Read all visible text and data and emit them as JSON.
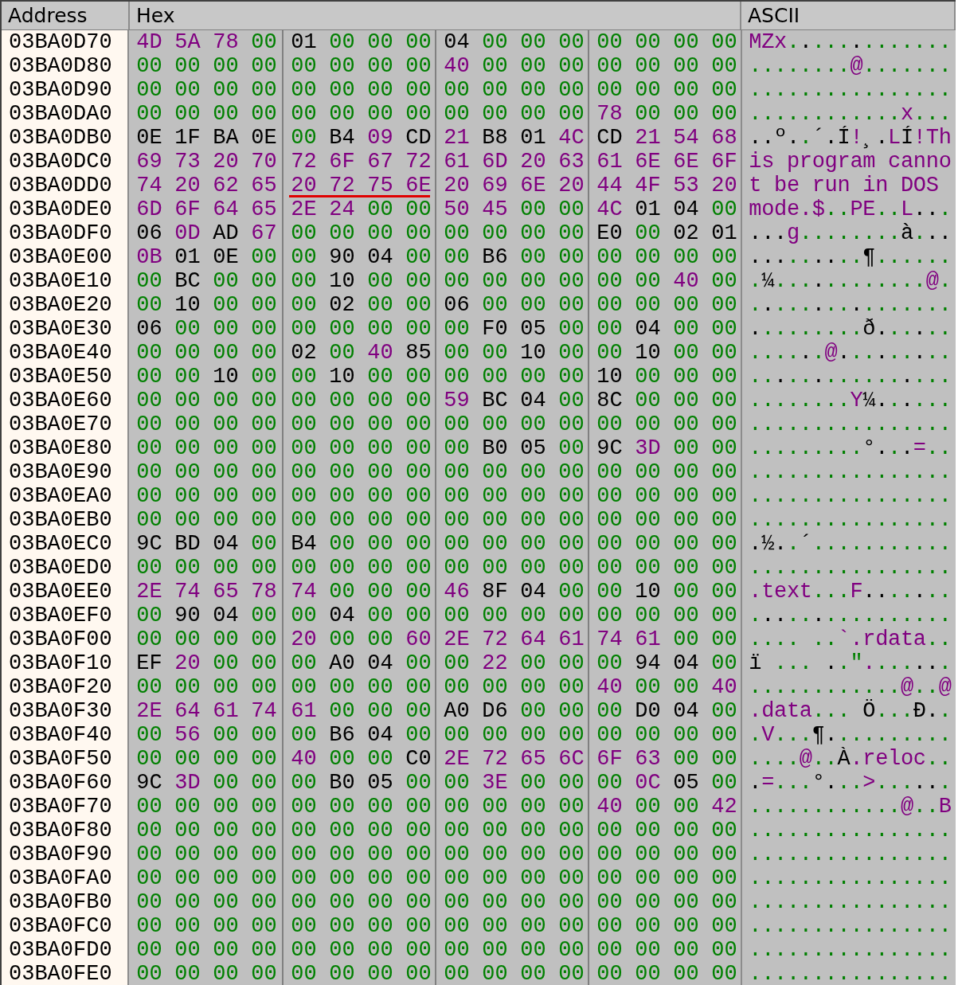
{
  "columns": [
    "Address",
    "Hex",
    "ASCII"
  ],
  "rows": [
    {
      "address": "03BA0D70",
      "hex": [
        "4D 5A 78 00",
        "01 00 00 00",
        "04 00 00 00",
        "00 00 00 00"
      ],
      "underlined": [
        false,
        false,
        false,
        false
      ],
      "ascii": "MZx............."
    },
    {
      "address": "03BA0D80",
      "hex": [
        "00 00 00 00",
        "00 00 00 00",
        "40 00 00 00",
        "00 00 00 00"
      ],
      "underlined": [
        false,
        false,
        false,
        false
      ],
      "ascii": "........@......."
    },
    {
      "address": "03BA0D90",
      "hex": [
        "00 00 00 00",
        "00 00 00 00",
        "00 00 00 00",
        "00 00 00 00"
      ],
      "underlined": [
        false,
        false,
        false,
        false
      ],
      "ascii": "................"
    },
    {
      "address": "03BA0DA0",
      "hex": [
        "00 00 00 00",
        "00 00 00 00",
        "00 00 00 00",
        "78 00 00 00"
      ],
      "underlined": [
        false,
        false,
        false,
        false
      ],
      "ascii": "............x..."
    },
    {
      "address": "03BA0DB0",
      "hex": [
        "0E 1F BA 0E",
        "00 B4 09 CD",
        "21 B8 01 4C",
        "CD 21 54 68"
      ],
      "underlined": [
        false,
        false,
        false,
        false
      ],
      "ascii": "..º..´.Í!¸.LÍ!Th"
    },
    {
      "address": "03BA0DC0",
      "hex": [
        "69 73 20 70",
        "72 6F 67 72",
        "61 6D 20 63",
        "61 6E 6E 6F"
      ],
      "underlined": [
        false,
        false,
        false,
        false
      ],
      "ascii": "is program canno"
    },
    {
      "address": "03BA0DD0",
      "hex": [
        "74 20 62 65",
        "20 72 75 6E",
        "20 69 6E 20",
        "44 4F 53 20"
      ],
      "underlined": [
        false,
        true,
        false,
        false
      ],
      "ascii": "t be run in DOS "
    },
    {
      "address": "03BA0DE0",
      "hex": [
        "6D 6F 64 65",
        "2E 24 00 00",
        "50 45 00 00",
        "4C 01 04 00"
      ],
      "underlined": [
        false,
        false,
        false,
        false
      ],
      "ascii": "mode.$..PE..L..."
    },
    {
      "address": "03BA0DF0",
      "hex": [
        "06 0D AD 67",
        "00 00 00 00",
        "00 00 00 00",
        "E0 00 02 01"
      ],
      "underlined": [
        false,
        false,
        false,
        false
      ],
      "ascii": "...g........à..."
    },
    {
      "address": "03BA0E00",
      "hex": [
        "0B 01 0E 00",
        "00 90 04 00",
        "00 B6 00 00",
        "00 00 00 00"
      ],
      "underlined": [
        false,
        false,
        false,
        false
      ],
      "ascii": ".........¶......"
    },
    {
      "address": "03BA0E10",
      "hex": [
        "00 BC 00 00",
        "00 10 00 00",
        "00 00 00 00",
        "00 00 40 00"
      ],
      "underlined": [
        false,
        false,
        false,
        false
      ],
      "ascii": ".¼............@."
    },
    {
      "address": "03BA0E20",
      "hex": [
        "00 10 00 00",
        "00 02 00 00",
        "06 00 00 00",
        "00 00 00 00"
      ],
      "underlined": [
        false,
        false,
        false,
        false
      ],
      "ascii": "................"
    },
    {
      "address": "03BA0E30",
      "hex": [
        "06 00 00 00",
        "00 00 00 00",
        "00 F0 05 00",
        "00 04 00 00"
      ],
      "underlined": [
        false,
        false,
        false,
        false
      ],
      "ascii": ".........ð......"
    },
    {
      "address": "03BA0E40",
      "hex": [
        "00 00 00 00",
        "02 00 40 85",
        "00 00 10 00",
        "00 10 00 00"
      ],
      "underlined": [
        false,
        false,
        false,
        false
      ],
      "ascii": "......@........."
    },
    {
      "address": "03BA0E50",
      "hex": [
        "00 00 10 00",
        "00 10 00 00",
        "00 00 00 00",
        "10 00 00 00"
      ],
      "underlined": [
        false,
        false,
        false,
        false
      ],
      "ascii": "................"
    },
    {
      "address": "03BA0E60",
      "hex": [
        "00 00 00 00",
        "00 00 00 00",
        "59 BC 04 00",
        "8C 00 00 00"
      ],
      "underlined": [
        false,
        false,
        false,
        false
      ],
      "ascii": "........Y¼......"
    },
    {
      "address": "03BA0E70",
      "hex": [
        "00 00 00 00",
        "00 00 00 00",
        "00 00 00 00",
        "00 00 00 00"
      ],
      "underlined": [
        false,
        false,
        false,
        false
      ],
      "ascii": "................"
    },
    {
      "address": "03BA0E80",
      "hex": [
        "00 00 00 00",
        "00 00 00 00",
        "00 B0 05 00",
        "9C 3D 00 00"
      ],
      "underlined": [
        false,
        false,
        false,
        false
      ],
      "ascii": ".........°...=.."
    },
    {
      "address": "03BA0E90",
      "hex": [
        "00 00 00 00",
        "00 00 00 00",
        "00 00 00 00",
        "00 00 00 00"
      ],
      "underlined": [
        false,
        false,
        false,
        false
      ],
      "ascii": "................"
    },
    {
      "address": "03BA0EA0",
      "hex": [
        "00 00 00 00",
        "00 00 00 00",
        "00 00 00 00",
        "00 00 00 00"
      ],
      "underlined": [
        false,
        false,
        false,
        false
      ],
      "ascii": "................"
    },
    {
      "address": "03BA0EB0",
      "hex": [
        "00 00 00 00",
        "00 00 00 00",
        "00 00 00 00",
        "00 00 00 00"
      ],
      "underlined": [
        false,
        false,
        false,
        false
      ],
      "ascii": "................"
    },
    {
      "address": "03BA0EC0",
      "hex": [
        "9C BD 04 00",
        "B4 00 00 00",
        "00 00 00 00",
        "00 00 00 00"
      ],
      "underlined": [
        false,
        false,
        false,
        false
      ],
      "ascii": ".½..´..........."
    },
    {
      "address": "03BA0ED0",
      "hex": [
        "00 00 00 00",
        "00 00 00 00",
        "00 00 00 00",
        "00 00 00 00"
      ],
      "underlined": [
        false,
        false,
        false,
        false
      ],
      "ascii": "................"
    },
    {
      "address": "03BA0EE0",
      "hex": [
        "2E 74 65 78",
        "74 00 00 00",
        "46 8F 04 00",
        "00 10 00 00"
      ],
      "underlined": [
        false,
        false,
        false,
        false
      ],
      "ascii": ".text...F......."
    },
    {
      "address": "03BA0EF0",
      "hex": [
        "00 90 04 00",
        "00 04 00 00",
        "00 00 00 00",
        "00 00 00 00"
      ],
      "underlined": [
        false,
        false,
        false,
        false
      ],
      "ascii": "................"
    },
    {
      "address": "03BA0F00",
      "hex": [
        "00 00 00 00",
        "20 00 00 60",
        "2E 72 64 61",
        "74 61 00 00"
      ],
      "underlined": [
        false,
        false,
        false,
        false
      ],
      "ascii": ".... ..`.rdata.."
    },
    {
      "address": "03BA0F10",
      "hex": [
        "EF 20 00 00",
        "00 A0 04 00",
        "00 22 00 00",
        "00 94 04 00"
      ],
      "underlined": [
        false,
        false,
        false,
        false
      ],
      "ascii": "ï ... ..\"......."
    },
    {
      "address": "03BA0F20",
      "hex": [
        "00 00 00 00",
        "00 00 00 00",
        "00 00 00 00",
        "40 00 00 40"
      ],
      "underlined": [
        false,
        false,
        false,
        false
      ],
      "ascii": "............@..@"
    },
    {
      "address": "03BA0F30",
      "hex": [
        "2E 64 61 74",
        "61 00 00 00",
        "A0 D6 00 00",
        "00 D0 04 00"
      ],
      "underlined": [
        false,
        false,
        false,
        false
      ],
      "ascii": ".data... Ö...Ð.."
    },
    {
      "address": "03BA0F40",
      "hex": [
        "00 56 00 00",
        "00 B6 04 00",
        "00 00 00 00",
        "00 00 00 00"
      ],
      "underlined": [
        false,
        false,
        false,
        false
      ],
      "ascii": ".V...¶.........."
    },
    {
      "address": "03BA0F50",
      "hex": [
        "00 00 00 00",
        "40 00 00 C0",
        "2E 72 65 6C",
        "6F 63 00 00"
      ],
      "underlined": [
        false,
        false,
        false,
        false
      ],
      "ascii": "....@..À.reloc.."
    },
    {
      "address": "03BA0F60",
      "hex": [
        "9C 3D 00 00",
        "00 B0 05 00",
        "00 3E 00 00",
        "00 0C 05 00"
      ],
      "underlined": [
        false,
        false,
        false,
        false
      ],
      "ascii": ".=...°...>......"
    },
    {
      "address": "03BA0F70",
      "hex": [
        "00 00 00 00",
        "00 00 00 00",
        "00 00 00 00",
        "40 00 00 42"
      ],
      "underlined": [
        false,
        false,
        false,
        false
      ],
      "ascii": "............@..B"
    },
    {
      "address": "03BA0F80",
      "hex": [
        "00 00 00 00",
        "00 00 00 00",
        "00 00 00 00",
        "00 00 00 00"
      ],
      "underlined": [
        false,
        false,
        false,
        false
      ],
      "ascii": "................"
    },
    {
      "address": "03BA0F90",
      "hex": [
        "00 00 00 00",
        "00 00 00 00",
        "00 00 00 00",
        "00 00 00 00"
      ],
      "underlined": [
        false,
        false,
        false,
        false
      ],
      "ascii": "................"
    },
    {
      "address": "03BA0FA0",
      "hex": [
        "00 00 00 00",
        "00 00 00 00",
        "00 00 00 00",
        "00 00 00 00"
      ],
      "underlined": [
        false,
        false,
        false,
        false
      ],
      "ascii": "................"
    },
    {
      "address": "03BA0FB0",
      "hex": [
        "00 00 00 00",
        "00 00 00 00",
        "00 00 00 00",
        "00 00 00 00"
      ],
      "underlined": [
        false,
        false,
        false,
        false
      ],
      "ascii": "................"
    },
    {
      "address": "03BA0FC0",
      "hex": [
        "00 00 00 00",
        "00 00 00 00",
        "00 00 00 00",
        "00 00 00 00"
      ],
      "underlined": [
        false,
        false,
        false,
        false
      ],
      "ascii": "................"
    },
    {
      "address": "03BA0FD0",
      "hex": [
        "00 00 00 00",
        "00 00 00 00",
        "00 00 00 00",
        "00 00 00 00"
      ],
      "underlined": [
        false,
        false,
        false,
        false
      ],
      "ascii": "................"
    },
    {
      "address": "03BA0FE0",
      "hex": [
        "00 00 00 00",
        "00 00 00 00",
        "00 00 00 00",
        "00 00 00 00"
      ],
      "underlined": [
        false,
        false,
        false,
        false
      ],
      "ascii": "................"
    }
  ]
}
